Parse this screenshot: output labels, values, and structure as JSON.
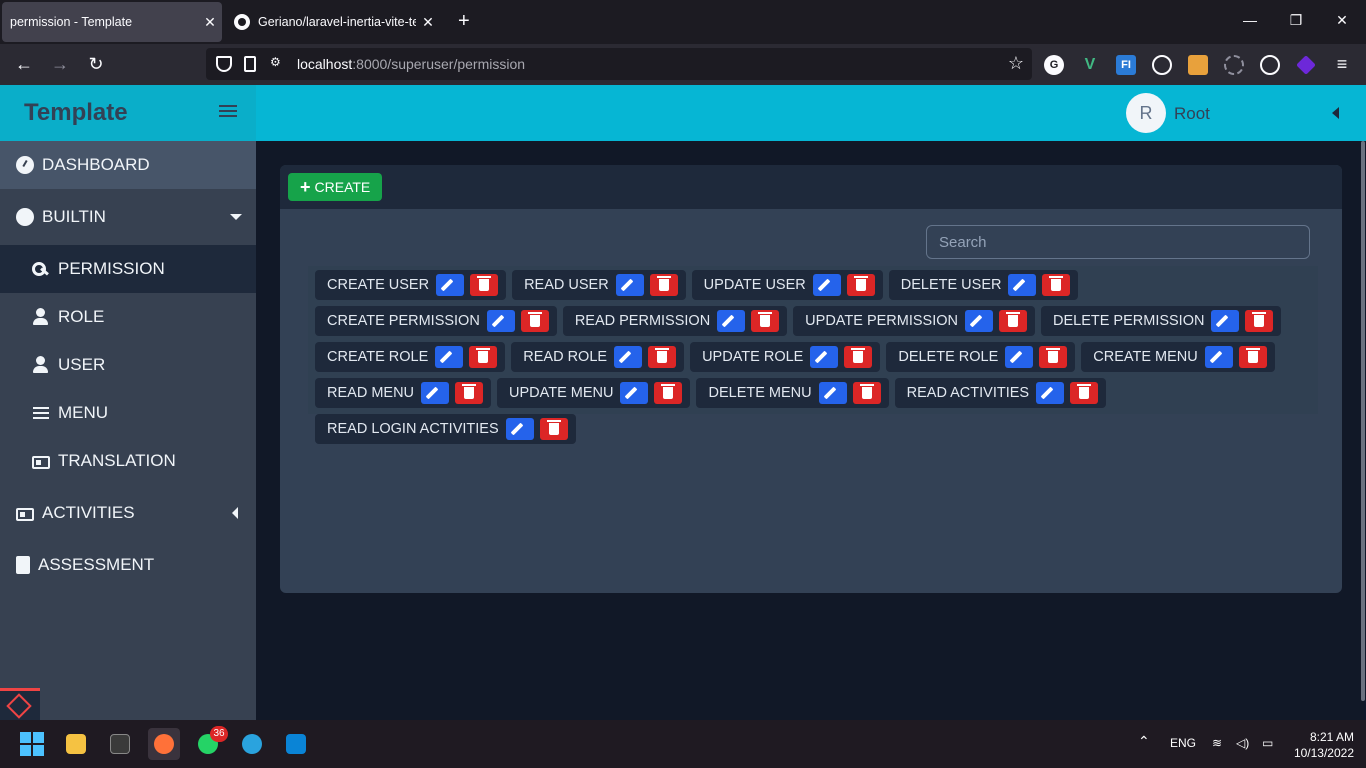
{
  "browser": {
    "tabs": [
      {
        "title": "permission - Template",
        "active": true
      },
      {
        "title": "Geriano/laravel-inertia-vite-tem",
        "active": false
      }
    ],
    "url_host": "localhost",
    "url_path": ":8000/superuser/permission",
    "extensions": [
      "G",
      "V",
      "FI"
    ]
  },
  "header": {
    "brand": "Template",
    "avatar_initial": "R",
    "username": "Root"
  },
  "sidebar": {
    "items": [
      {
        "label": "DASHBOARD",
        "icon": "gauge-icon"
      },
      {
        "label": "BUILTIN",
        "icon": "circle-icon"
      },
      {
        "label": "PERMISSION",
        "icon": "key-icon"
      },
      {
        "label": "ROLE",
        "icon": "user-gear-icon"
      },
      {
        "label": "USER",
        "icon": "user-icon"
      },
      {
        "label": "MENU",
        "icon": "bars-icon"
      },
      {
        "label": "TRANSLATION",
        "icon": "language-icon"
      },
      {
        "label": "ACTIVITIES",
        "icon": "id-card-icon"
      },
      {
        "label": "ASSESSMENT",
        "icon": "file-clock-icon"
      }
    ]
  },
  "main": {
    "create_label": "CREATE",
    "search_placeholder": "Search",
    "permissions": [
      "CREATE USER",
      "READ USER",
      "UPDATE USER",
      "DELETE USER",
      "CREATE PERMISSION",
      "READ PERMISSION",
      "UPDATE PERMISSION",
      "DELETE PERMISSION",
      "CREATE ROLE",
      "READ ROLE",
      "UPDATE ROLE",
      "DELETE ROLE",
      "CREATE MENU",
      "READ MENU",
      "UPDATE MENU",
      "DELETE MENU",
      "READ ACTIVITIES",
      "READ LOGIN ACTIVITIES"
    ]
  },
  "taskbar": {
    "whatsapp_badge": "36",
    "language": "ENG",
    "time": "8:21 AM",
    "date": "10/13/2022"
  },
  "colors": {
    "header_bg": "#06b6d4",
    "create_btn": "#16a34a",
    "edit_btn": "#2563eb",
    "delete_btn": "#dc2626"
  }
}
